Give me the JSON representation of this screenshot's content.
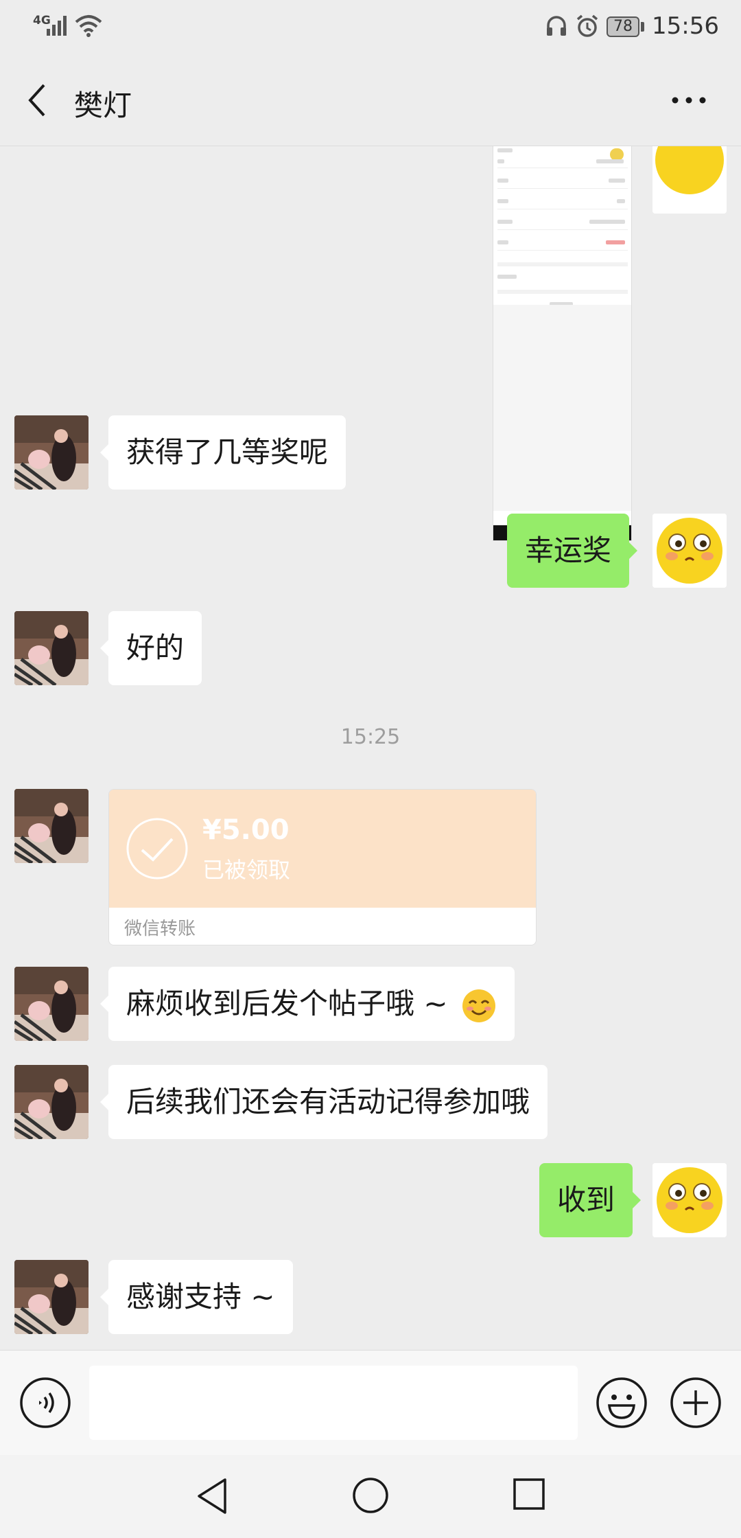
{
  "status_bar": {
    "network": "4G",
    "battery": "78",
    "time": "15:56"
  },
  "header": {
    "title": "樊灯"
  },
  "messages": [
    {
      "type": "image",
      "side": "right",
      "description": "screenshot"
    },
    {
      "type": "text",
      "side": "left",
      "text": "获得了几等奖呢"
    },
    {
      "type": "text",
      "side": "right",
      "text": "幸运奖"
    },
    {
      "type": "text",
      "side": "left",
      "text": "好的"
    },
    {
      "type": "time",
      "text": "15:25"
    },
    {
      "type": "transfer",
      "side": "left",
      "amount": "¥5.00",
      "status": "已被领取",
      "label": "微信转账"
    },
    {
      "type": "text",
      "side": "left",
      "text": "麻烦收到后发个帖子哦 ~"
    },
    {
      "type": "text",
      "side": "left",
      "text": "后续我们还会有活动记得参加哦"
    },
    {
      "type": "text",
      "side": "right",
      "text": "收到"
    },
    {
      "type": "text",
      "side": "left",
      "text": "感谢支持 ~"
    }
  ],
  "input": {
    "value": ""
  },
  "colors": {
    "background": "#ededed",
    "sent_bubble": "#95ec69",
    "received_bubble": "#ffffff",
    "transfer": "#fce2c8"
  },
  "icons": [
    "back-arrow-icon",
    "more-icon",
    "voice-icon",
    "emoji-icon",
    "plus-icon",
    "smile-emoji-icon",
    "nav-back-icon",
    "nav-home-icon",
    "nav-recent-icon"
  ]
}
